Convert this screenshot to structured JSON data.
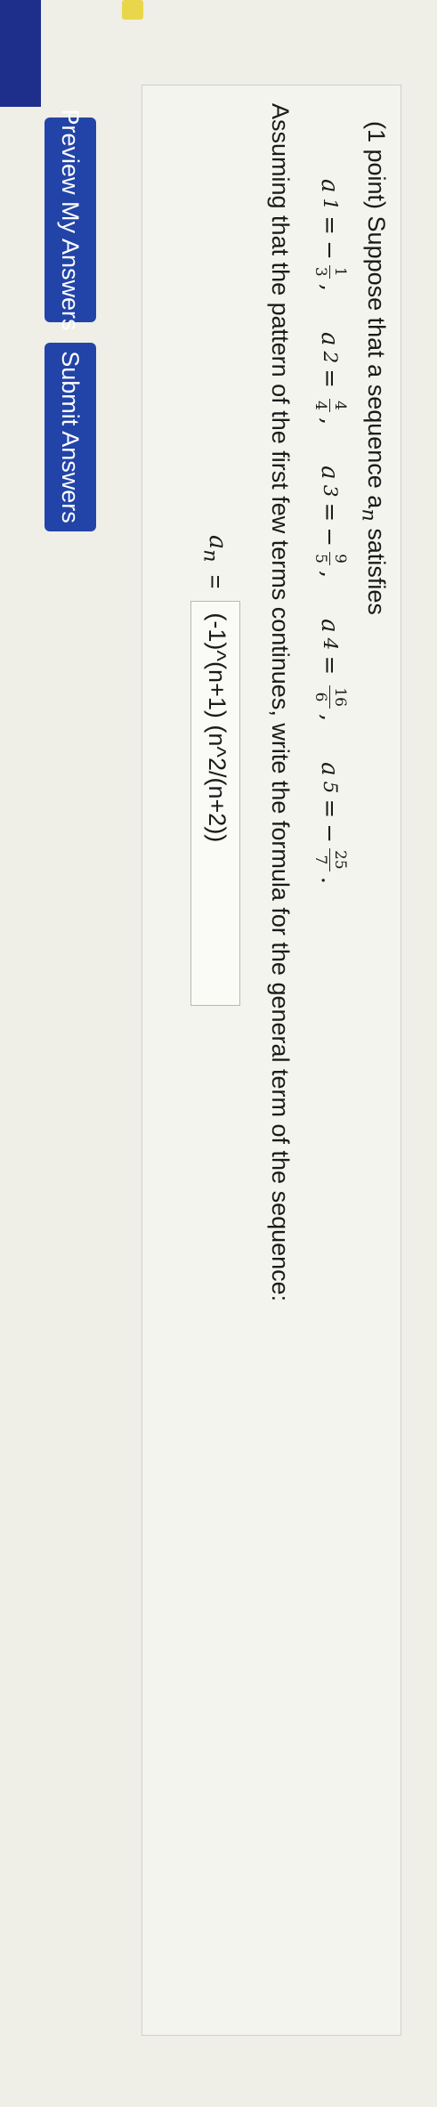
{
  "problem": {
    "intro": "(1 point) Suppose that a sequence a",
    "intro_sub": "n",
    "intro_end": " satisfies",
    "terms": [
      {
        "label": "a",
        "sub": "1",
        "sign": "−",
        "num": "1",
        "den": "3",
        "sep": ","
      },
      {
        "label": "a",
        "sub": "2",
        "sign": "",
        "num": "4",
        "den": "4",
        "sep": ","
      },
      {
        "label": "a",
        "sub": "3",
        "sign": "−",
        "num": "9",
        "den": "5",
        "sep": ","
      },
      {
        "label": "a",
        "sub": "4",
        "sign": "",
        "num": "16",
        "den": "6",
        "sep": ","
      },
      {
        "label": "a",
        "sub": "5",
        "sign": "−",
        "num": "25",
        "den": "7",
        "sep": "."
      }
    ],
    "instruction": "Assuming that the pattern of the first few terms continues, write the formula for the general term of the sequence:",
    "formula_label": "a",
    "formula_sub": "n",
    "formula_eq": "=",
    "answer_value": "(-1)^(n+1) (n^2/(n+2))"
  },
  "buttons": {
    "preview": "Preview My Answers",
    "submit": "Submit Answers"
  },
  "colors": {
    "button_bg": "#2244a8",
    "top_accent": "#1d2f8a",
    "yellow_marker": "#e9d64a"
  }
}
